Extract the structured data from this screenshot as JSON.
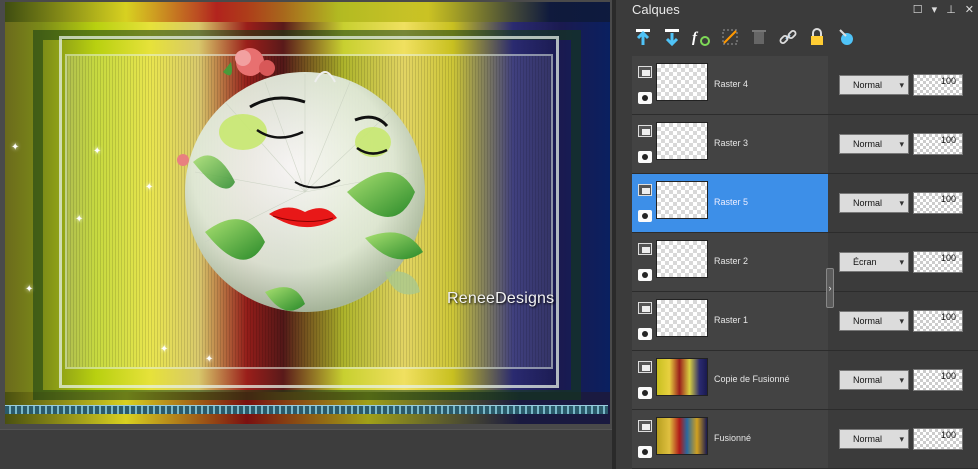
{
  "panel": {
    "title": "Calques",
    "controls": [
      "window-icon",
      "dropdown-icon",
      "pin-icon",
      "close-icon"
    ],
    "toolbar": [
      {
        "name": "new-raster-layer-icon",
        "color": "#4fc3f7"
      },
      {
        "name": "new-vector-layer-icon",
        "color": "#4fc3f7"
      },
      {
        "name": "layer-style-icon",
        "color": "#ffffff"
      },
      {
        "name": "mask-icon",
        "color": "#ff9800"
      },
      {
        "name": "delete-layer-icon",
        "color": "#777777"
      },
      {
        "name": "link-icon",
        "color": "#90caf9"
      },
      {
        "name": "lock-icon",
        "color": "#ffcc33"
      },
      {
        "name": "properties-icon",
        "color": "#4fc3f7"
      }
    ]
  },
  "layers": [
    {
      "name": "Raster 4",
      "blend": "Normal",
      "opacity": "100",
      "selected": false,
      "thumb": "transparent"
    },
    {
      "name": "Raster 3",
      "blend": "Normal",
      "opacity": "100",
      "selected": false,
      "thumb": "transparent"
    },
    {
      "name": "Raster 5",
      "blend": "Normal",
      "opacity": "100",
      "selected": true,
      "thumb": "transparent"
    },
    {
      "name": "Raster 2",
      "blend": "Écran",
      "opacity": "100",
      "selected": false,
      "thumb": "transparent"
    },
    {
      "name": "Raster 1",
      "blend": "Normal",
      "opacity": "100",
      "selected": false,
      "thumb": "transparent"
    },
    {
      "name": "Copie de Fusionné",
      "blend": "Normal",
      "opacity": "100",
      "selected": false,
      "thumb": "art"
    },
    {
      "name": "Fusionné",
      "blend": "Normal",
      "opacity": "100",
      "selected": false,
      "thumb": "art2"
    }
  ],
  "canvas": {
    "watermark": "ReneeDesigns"
  },
  "colors": {
    "selected_row": "#3d8fe8",
    "panel_bg": "#3b3b3b"
  }
}
